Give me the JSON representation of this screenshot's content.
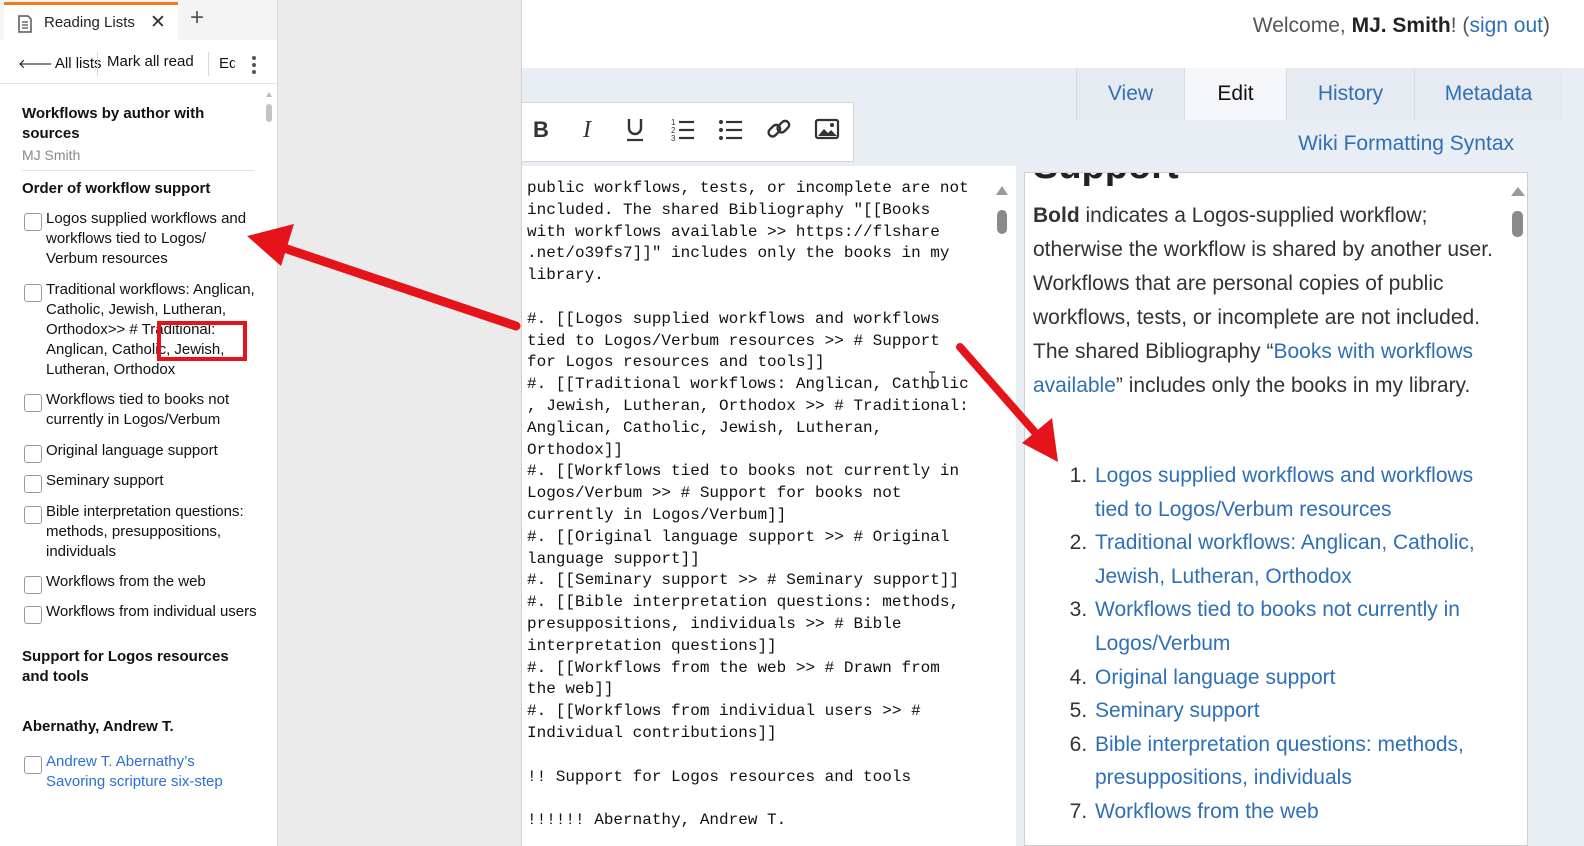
{
  "left_panel": {
    "tab_title": "Reading Lists",
    "tab_close": "✕",
    "tab_add": "+",
    "toolbar": {
      "all_lists": "All lists",
      "mark_all_read": "Mark all read",
      "edit_truncated": "Edit"
    },
    "list_title": "Workflows by author with sources",
    "list_author": "MJ Smith",
    "section_order": "Order of workflow support",
    "items": [
      "Logos supplied workflows and workflows tied to Logos/ Verbum resources",
      "Traditional workflows: Anglican, Catholic, Jewish, Lutheran, Orthodox>> # Traditional: Anglican, Catholic, Jewish, Lutheran, Orthodox",
      "Workflows tied to books not currently in Logos/Verbum",
      "Original language support",
      "Seminary support",
      "Bible interpretation questions: methods, presuppositions, individuals",
      "Workflows from the web",
      "Workflows from individual users"
    ],
    "section_support": "Support for Logos resources and tools",
    "section_author": "Abernathy, Andrew T.",
    "author_item": "Andrew T. Abernathy’s Savoring scripture six-step"
  },
  "header": {
    "welcome_prefix": "Welcome, ",
    "user_name": "MJ. Smith",
    "welcome_mid": "! (",
    "sign_out": "sign out",
    "welcome_suffix": ")"
  },
  "tabs": [
    "View",
    "Edit",
    "History",
    "Metadata"
  ],
  "active_tab": "Edit",
  "editor_toolbar_icons": [
    "bold-icon",
    "italic-icon",
    "underline-icon",
    "numbered-list-icon",
    "bulleted-list-icon",
    "link-icon",
    "image-icon"
  ],
  "syntax_link": "Wiki Formatting Syntax",
  "editor_text": "public workflows, tests, or incomplete are not\nincluded. The shared Bibliography \"[[Books\nwith workflows available >> https://flshare\n.net/o39fs7]]\" includes only the books in my\nlibrary.\n\n#. [[Logos supplied workflows and workflows\ntied to Logos/Verbum resources >> # Support\nfor Logos resources and tools]]\n#. [[Traditional workflows: Anglican, Catholic\n, Jewish, Lutheran, Orthodox >> # Traditional:\nAnglican, Catholic, Jewish, Lutheran,\nOrthodox]]\n#. [[Workflows tied to books not currently in\nLogos/Verbum >> # Support for books not\ncurrently in Logos/Verbum]]\n#. [[Original language support >> # Original\nlanguage support]]\n#. [[Seminary support >> # Seminary support]]\n#. [[Bible interpretation questions: methods,\npresuppositions, individuals >> # Bible\ninterpretation questions]]\n#. [[Workflows from the web >> # Drawn from\nthe web]]\n#. [[Workflows from individual users >> #\nIndividual contributions]]\n\n!! Support for Logos resources and tools\n\n!!!!!! Abernathy, Andrew T.",
  "preview": {
    "heading_partial": "Support",
    "bold_word": "Bold",
    "para_1": " indicates a Logos-supplied workflow; otherwise the workflow is shared by another user. Workflows that are personal copies of public workflows, tests, or incomplete are not included. The shared Bibliography “",
    "para_link": "Books with workflows available",
    "para_2": "” includes only the books in my library.",
    "list": [
      "Logos supplied workflows and workflows tied to Logos/Verbum resources",
      "Traditional workflows: Anglican, Catholic, Jewish, Lutheran, Orthodox",
      "Workflows tied to books not currently in Logos/Verbum",
      "Original language support",
      "Seminary support",
      "Bible interpretation questions: methods, presuppositions, individuals",
      "Workflows from the web"
    ]
  },
  "colors": {
    "accent_tab": "#f07c1e",
    "link_blue": "#2e6fb7",
    "annotation_red": "#e5141b",
    "band": "#e9eef5"
  }
}
